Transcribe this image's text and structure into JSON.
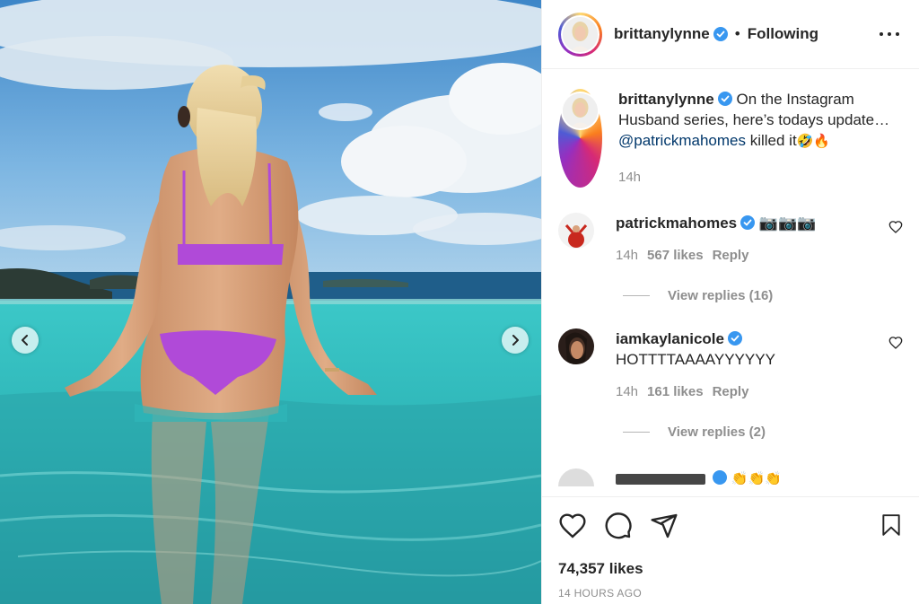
{
  "header": {
    "username": "brittanylynne",
    "separator": "•",
    "follow_status": "Following"
  },
  "caption": {
    "username": "brittanylynne",
    "text": "On the Instagram Husband series, here’s todays update…",
    "mention": "@patrickmahomes",
    "tail": "killed it",
    "emojis": "🤣🔥",
    "time": "14h"
  },
  "comments": [
    {
      "username": "patrickmahomes",
      "text": "📷📷📷",
      "time": "14h",
      "likes": "567 likes",
      "reply": "Reply",
      "view_replies": "View replies (16)"
    },
    {
      "username": "iamkaylanicole",
      "text": "HOTTTTAAAAYYYYYY",
      "time": "14h",
      "likes": "161 likes",
      "reply": "Reply",
      "view_replies": "View replies (2)"
    }
  ],
  "partial_comment": {
    "text": "👏👏👏"
  },
  "footer": {
    "likes": "74,357 likes",
    "posted": "14 HOURS AGO"
  },
  "colors": {
    "verified": "#3897f0",
    "link": "#00376b",
    "muted": "#8e8e8e",
    "bikini": "#b04ad8"
  },
  "icons": [
    "heart-icon",
    "comment-icon",
    "share-icon",
    "bookmark-icon",
    "more-icon",
    "chevron-left-icon",
    "chevron-right-icon",
    "verified-icon"
  ]
}
